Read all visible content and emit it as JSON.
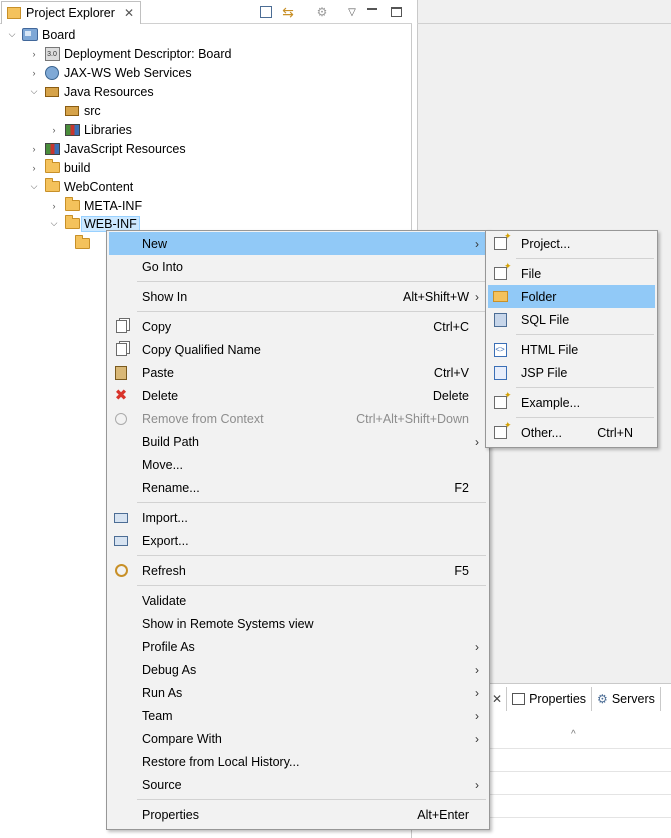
{
  "explorer": {
    "title": "Project Explorer",
    "close_glyph": "✕",
    "tree": [
      {
        "label": "Board",
        "icon": "project-icon",
        "twisty": "expanded"
      },
      {
        "label": "Deployment Descriptor: Board",
        "icon": "descriptor-icon",
        "twisty": "collapsed"
      },
      {
        "label": "JAX-WS Web Services",
        "icon": "web-services-icon",
        "twisty": "collapsed"
      },
      {
        "label": "Java Resources",
        "icon": "java-resources-icon",
        "twisty": "expanded"
      },
      {
        "label": "src",
        "icon": "package-folder-icon",
        "twisty": "none"
      },
      {
        "label": "Libraries",
        "icon": "libraries-icon",
        "twisty": "collapsed"
      },
      {
        "label": "JavaScript Resources",
        "icon": "javascript-resources-icon",
        "twisty": "collapsed"
      },
      {
        "label": "build",
        "icon": "folder-icon",
        "twisty": "collapsed"
      },
      {
        "label": "WebContent",
        "icon": "folder-icon",
        "twisty": "expanded"
      },
      {
        "label": "META-INF",
        "icon": "folder-icon",
        "twisty": "collapsed"
      },
      {
        "label": "WEB-INF",
        "icon": "folder-icon",
        "twisty": "expanded"
      }
    ]
  },
  "context_menu": {
    "items": [
      {
        "label": "New",
        "accel": "",
        "arrow": "›"
      },
      {
        "label": "Go Into",
        "accel": "",
        "arrow": ""
      },
      {
        "label": "Show In",
        "accel": "Alt+Shift+W",
        "arrow": "›"
      },
      {
        "label": "Copy",
        "accel": "Ctrl+C",
        "arrow": ""
      },
      {
        "label": "Copy Qualified Name",
        "accel": "",
        "arrow": ""
      },
      {
        "label": "Paste",
        "accel": "Ctrl+V",
        "arrow": ""
      },
      {
        "label": "Delete",
        "accel": "Delete",
        "arrow": ""
      },
      {
        "label": "Remove from Context",
        "accel": "Ctrl+Alt+Shift+Down",
        "arrow": ""
      },
      {
        "label": "Build Path",
        "accel": "",
        "arrow": "›"
      },
      {
        "label": "Move...",
        "accel": "",
        "arrow": ""
      },
      {
        "label": "Rename...",
        "accel": "F2",
        "arrow": ""
      },
      {
        "label": "Import...",
        "accel": "",
        "arrow": ""
      },
      {
        "label": "Export...",
        "accel": "",
        "arrow": ""
      },
      {
        "label": "Refresh",
        "accel": "F5",
        "arrow": ""
      },
      {
        "label": "Validate",
        "accel": "",
        "arrow": ""
      },
      {
        "label": "Show in Remote Systems view",
        "accel": "",
        "arrow": ""
      },
      {
        "label": "Profile As",
        "accel": "",
        "arrow": "›"
      },
      {
        "label": "Debug As",
        "accel": "",
        "arrow": "›"
      },
      {
        "label": "Run As",
        "accel": "",
        "arrow": "›"
      },
      {
        "label": "Team",
        "accel": "",
        "arrow": "›"
      },
      {
        "label": "Compare With",
        "accel": "",
        "arrow": "›"
      },
      {
        "label": "Restore from Local History...",
        "accel": "",
        "arrow": ""
      },
      {
        "label": "Source",
        "accel": "",
        "arrow": "›"
      },
      {
        "label": "Properties",
        "accel": "Alt+Enter",
        "arrow": ""
      }
    ]
  },
  "submenu": {
    "items": [
      {
        "label": "Project...",
        "accel": ""
      },
      {
        "label": "File",
        "accel": ""
      },
      {
        "label": "Folder",
        "accel": ""
      },
      {
        "label": "SQL File",
        "accel": ""
      },
      {
        "label": "HTML File",
        "accel": ""
      },
      {
        "label": "JSP File",
        "accel": ""
      },
      {
        "label": "Example...",
        "accel": ""
      },
      {
        "label": "Other...",
        "accel": "Ctrl+N"
      }
    ]
  },
  "bottom_panel": {
    "tabs": [
      {
        "label": "Properties",
        "icon": "properties-icon"
      },
      {
        "label": "Servers",
        "icon": "servers-icon"
      }
    ],
    "close_glyph": "✕",
    "sort_caret": "^"
  }
}
